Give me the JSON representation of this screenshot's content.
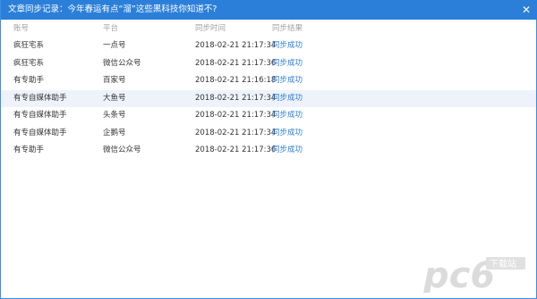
{
  "window": {
    "title": "文章同步记录：今年春运有点“溜”这些黑科技你知道不?"
  },
  "table": {
    "headers": [
      "账号",
      "平台",
      "同步时间",
      "同步结果"
    ],
    "rows": [
      {
        "account": "疯狂宅系",
        "platform": "一点号",
        "time": "2018-02-21 21:17:34",
        "result": "同步成功"
      },
      {
        "account": "疯狂宅系",
        "platform": "微信公众号",
        "time": "2018-02-21 21:17:36",
        "result": "同步成功"
      },
      {
        "account": "有专助手",
        "platform": "百家号",
        "time": "2018-02-21 21:16:18",
        "result": "同步成功"
      },
      {
        "account": "有专自媒体助手",
        "platform": "大鱼号",
        "time": "2018-02-21 21:17:34",
        "result": "同步成功"
      },
      {
        "account": "有专自媒体助手",
        "platform": "头条号",
        "time": "2018-02-21 21:17:34",
        "result": "同步成功"
      },
      {
        "account": "有专自媒体助手",
        "platform": "企鹅号",
        "time": "2018-02-21 21:17:34",
        "result": "同步成功"
      },
      {
        "account": "有专助手",
        "platform": "微信公众号",
        "time": "2018-02-21 21:17:36",
        "result": "同步成功"
      }
    ]
  },
  "watermark": {
    "brand": "pc6",
    "tagline": "下载站"
  },
  "colors": {
    "titlebar": "#2b7fd9",
    "link": "#2b7fd9",
    "row_highlight": "#eef3fb"
  }
}
